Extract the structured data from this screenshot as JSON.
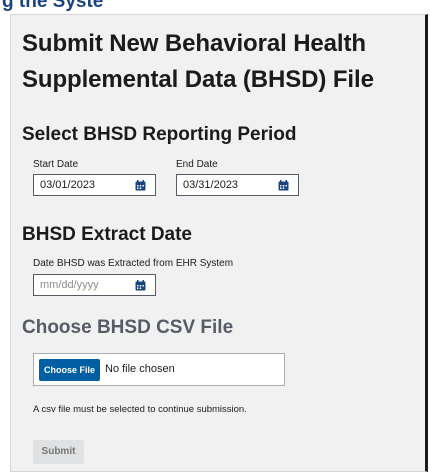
{
  "top_strip_text": "g  the  Syste",
  "page": {
    "title_line1": "Submit New Behavioral Health",
    "title_line2": "Supplemental Data (BHSD) File"
  },
  "reporting_period": {
    "heading": "Select BHSD Reporting Period",
    "start_label": "Start Date",
    "start_value": "03/01/2023",
    "end_label": "End Date",
    "end_value": "03/31/2023"
  },
  "extract_date": {
    "heading": "BHSD Extract Date",
    "label": "Date BHSD was Extracted from EHR System",
    "placeholder": "mm/dd/yyyy"
  },
  "csv_file": {
    "heading": "Choose BHSD CSV File",
    "button_label": "Choose File",
    "status": "No file chosen",
    "note": "A csv file must be selected to continue submission."
  },
  "submit_label": "Submit",
  "colors": {
    "primary": "#005ea2",
    "heading_link": "#1a4480",
    "disabled_bg": "#dfe1e2",
    "disabled_text": "#757575",
    "panel_bg": "#f1f1f1"
  }
}
